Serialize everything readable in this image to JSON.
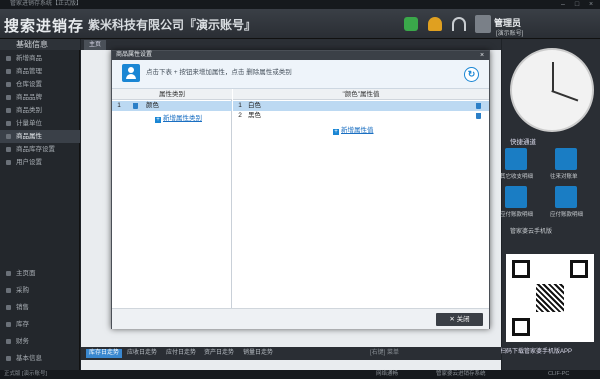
{
  "app": {
    "window_title": "管家进销存系统【正式版】",
    "logo": "搜索进销存",
    "company": "紫米科技有限公司『演示账号』",
    "user_role": "管理员",
    "user_account": "[演示账号]"
  },
  "sidebar": {
    "section_title": "基础信息",
    "items": [
      {
        "label": "新增商品"
      },
      {
        "label": "商品管理"
      },
      {
        "label": "仓库设置"
      },
      {
        "label": "商品品牌"
      },
      {
        "label": "商品类别"
      },
      {
        "label": "计量单位"
      },
      {
        "label": "商品属性"
      },
      {
        "label": "商品库存设置"
      },
      {
        "label": "用户设置"
      }
    ],
    "bottom_items": [
      {
        "label": "主页面"
      },
      {
        "label": "采购"
      },
      {
        "label": "销售"
      },
      {
        "label": "库存"
      },
      {
        "label": "财务"
      },
      {
        "label": "基本信息"
      }
    ]
  },
  "tabs": {
    "home": "主页"
  },
  "bottom_tabs": [
    "库存日走势",
    "应收日走势",
    "应付日走势",
    "资产日走势",
    "销量日走势"
  ],
  "bottom_right": "[右键] 菜单",
  "statusbar": {
    "left": "正式版 [演示账号]",
    "mid1": "网络通畅",
    "mid2": "管家婆云进销存系统",
    "right": "CLIF-PC"
  },
  "dialog": {
    "title": "商品属性设置",
    "tip": "点击下表 + 按钮来增加属性，点击 删除属性或类别",
    "left_header": "属性类别",
    "right_header": "\"颜色\"属性值",
    "categories": [
      {
        "num": "1",
        "name": "颜色"
      }
    ],
    "add_category": "新增属性类别",
    "values": [
      {
        "num": "1",
        "name": "白色"
      },
      {
        "num": "2",
        "name": "黑色"
      }
    ],
    "add_value": "新增属性值",
    "close_label": "关闭"
  },
  "right_panel": {
    "shortcut_title": "快捷通道",
    "shortcuts": [
      "其它收支明细",
      "往来对账单",
      "应付账款明细",
      "应付账款明细"
    ],
    "qr_title": "管家婆云手机版",
    "qr_caption": "扫码下载管家婆手机版APP"
  },
  "colors": {
    "accent": "#1a86d4",
    "header_bg": "#2a2e34",
    "selection": "#bcd9f2"
  }
}
